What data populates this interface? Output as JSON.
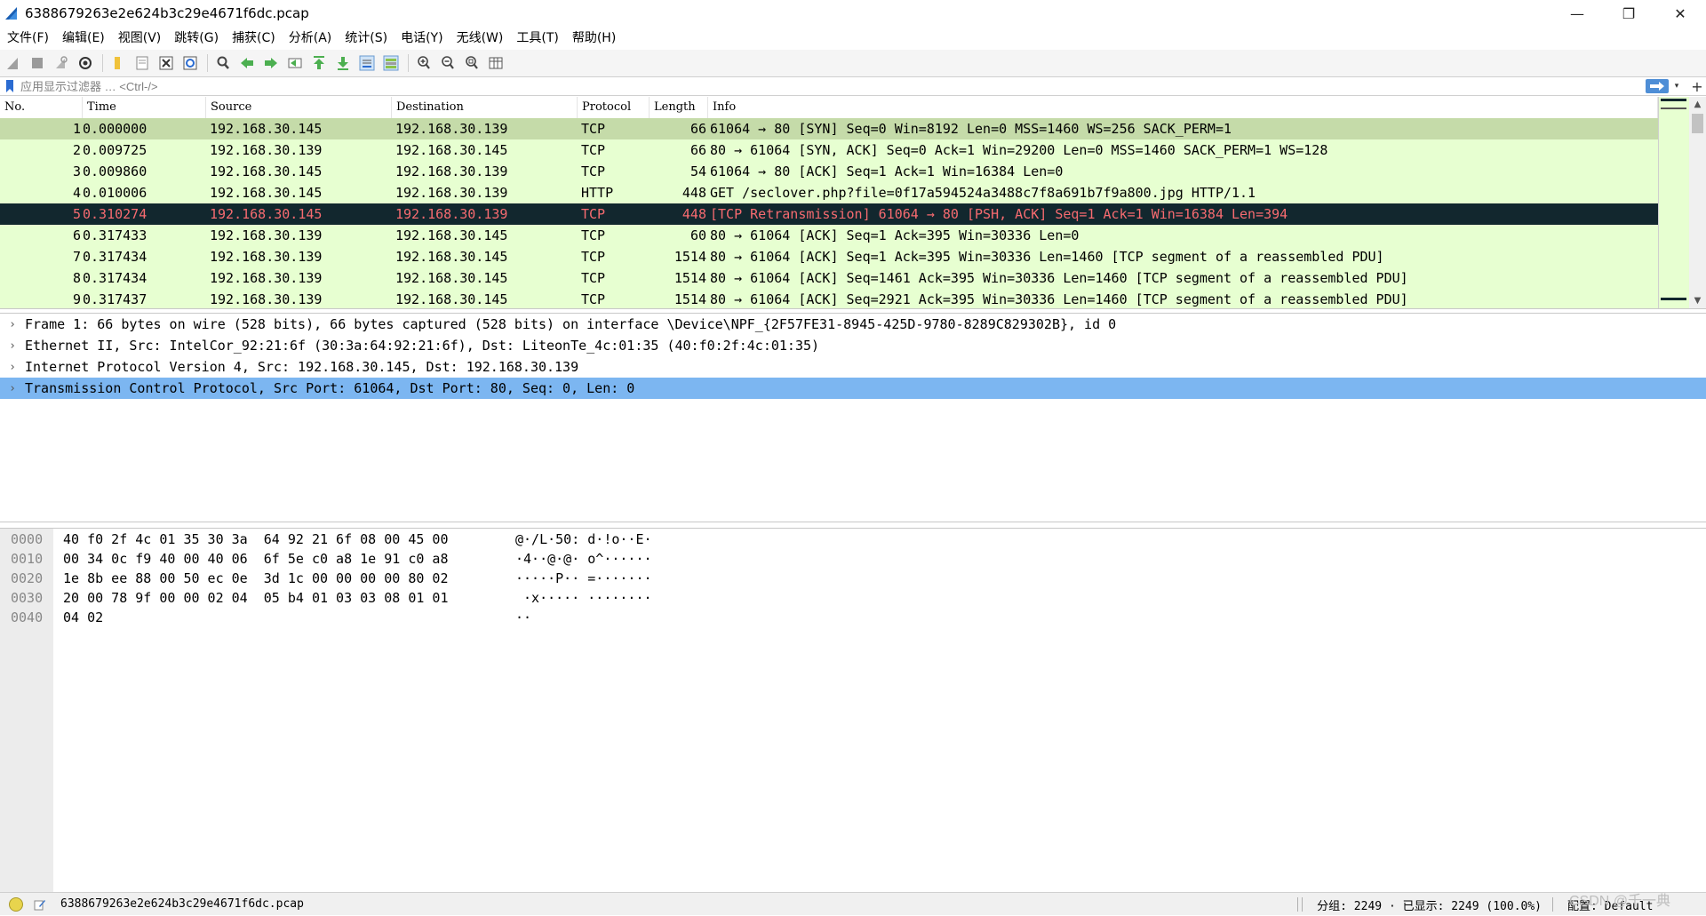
{
  "window": {
    "title": "6388679263e2e624b3c29e4671f6dc.pcap",
    "minimize": "—",
    "restore": "❐",
    "close": "✕"
  },
  "menu": [
    "文件(F)",
    "编辑(E)",
    "视图(V)",
    "跳转(G)",
    "捕获(C)",
    "分析(A)",
    "统计(S)",
    "电话(Y)",
    "无线(W)",
    "工具(T)",
    "帮助(H)"
  ],
  "filter": {
    "placeholder": "应用显示过滤器 … <Ctrl-/>",
    "add": "+"
  },
  "packet_list": {
    "columns": [
      "No.",
      "Time",
      "Source",
      "Destination",
      "Protocol",
      "Length",
      "Info"
    ],
    "rows": [
      {
        "no": "1",
        "time": "0.000000",
        "src": "192.168.30.145",
        "dst": "192.168.30.139",
        "proto": "TCP",
        "len": "66",
        "info": "61064 → 80 [SYN] Seq=0 Win=8192 Len=0 MSS=1460 WS=256 SACK_PERM=1"
      },
      {
        "no": "2",
        "time": "0.009725",
        "src": "192.168.30.139",
        "dst": "192.168.30.145",
        "proto": "TCP",
        "len": "66",
        "info": "80 → 61064 [SYN, ACK] Seq=0 Ack=1 Win=29200 Len=0 MSS=1460 SACK_PERM=1 WS=128"
      },
      {
        "no": "3",
        "time": "0.009860",
        "src": "192.168.30.145",
        "dst": "192.168.30.139",
        "proto": "TCP",
        "len": "54",
        "info": "61064 → 80 [ACK] Seq=1 Ack=1 Win=16384 Len=0"
      },
      {
        "no": "4",
        "time": "0.010006",
        "src": "192.168.30.145",
        "dst": "192.168.30.139",
        "proto": "HTTP",
        "len": "448",
        "info": "GET /seclover.php?file=0f17a594524a3488c7f8a691b7f9a800.jpg HTTP/1.1"
      },
      {
        "no": "5",
        "time": "0.310274",
        "src": "192.168.30.145",
        "dst": "192.168.30.139",
        "proto": "TCP",
        "len": "448",
        "info": "[TCP Retransmission] 61064 → 80 [PSH, ACK] Seq=1 Ack=1 Win=16384 Len=394"
      },
      {
        "no": "6",
        "time": "0.317433",
        "src": "192.168.30.139",
        "dst": "192.168.30.145",
        "proto": "TCP",
        "len": "60",
        "info": "80 → 61064 [ACK] Seq=1 Ack=395 Win=30336 Len=0"
      },
      {
        "no": "7",
        "time": "0.317434",
        "src": "192.168.30.139",
        "dst": "192.168.30.145",
        "proto": "TCP",
        "len": "1514",
        "info": "80 → 61064 [ACK] Seq=1 Ack=395 Win=30336 Len=1460 [TCP segment of a reassembled PDU]"
      },
      {
        "no": "8",
        "time": "0.317434",
        "src": "192.168.30.139",
        "dst": "192.168.30.145",
        "proto": "TCP",
        "len": "1514",
        "info": "80 → 61064 [ACK] Seq=1461 Ack=395 Win=30336 Len=1460 [TCP segment of a reassembled PDU]"
      },
      {
        "no": "9",
        "time": "0.317437",
        "src": "192.168.30.139",
        "dst": "192.168.30.145",
        "proto": "TCP",
        "len": "1514",
        "info": "80 → 61064 [ACK] Seq=2921 Ack=395 Win=30336 Len=1460 [TCP segment of a reassembled PDU]"
      }
    ]
  },
  "detail_tree": [
    "Frame 1: 66 bytes on wire (528 bits), 66 bytes captured (528 bits) on interface \\Device\\NPF_{2F57FE31-8945-425D-9780-8289C829302B}, id 0",
    "Ethernet II, Src: IntelCor_92:21:6f (30:3a:64:92:21:6f), Dst: LiteonTe_4c:01:35 (40:f0:2f:4c:01:35)",
    "Internet Protocol Version 4, Src: 192.168.30.145, Dst: 192.168.30.139",
    "Transmission Control Protocol, Src Port: 61064, Dst Port: 80, Seq: 0, Len: 0"
  ],
  "hex": [
    {
      "offset": "0000",
      "bytes": "40 f0 2f 4c 01 35 30 3a  64 92 21 6f 08 00 45 00",
      "ascii": "@·/L·50: d·!o··E·"
    },
    {
      "offset": "0010",
      "bytes": "00 34 0c f9 40 00 40 06  6f 5e c0 a8 1e 91 c0 a8",
      "ascii": "·4··@·@· o^······"
    },
    {
      "offset": "0020",
      "bytes": "1e 8b ee 88 00 50 ec 0e  3d 1c 00 00 00 00 80 02",
      "ascii": "·····P·· =·······"
    },
    {
      "offset": "0030",
      "bytes": "20 00 78 9f 00 00 02 04  05 b4 01 03 03 08 01 01",
      "ascii": " ·x····· ········"
    },
    {
      "offset": "0040",
      "bytes": "04 02",
      "ascii": "··"
    }
  ],
  "status": {
    "file": "6388679263e2e624b3c29e4671f6dc.pcap",
    "packets": "分组: 2249 · 已显示: 2249 (100.0%)",
    "profile": "配置: Default",
    "watermark": "CSDN @千一典"
  },
  "colors": {
    "row_default": "#e7ffd1",
    "row_first": "#c5dba9",
    "row_selected_bg": "#12272e",
    "row_selected_fg": "#f76b70",
    "detail_selected": "#7cb6f1"
  }
}
